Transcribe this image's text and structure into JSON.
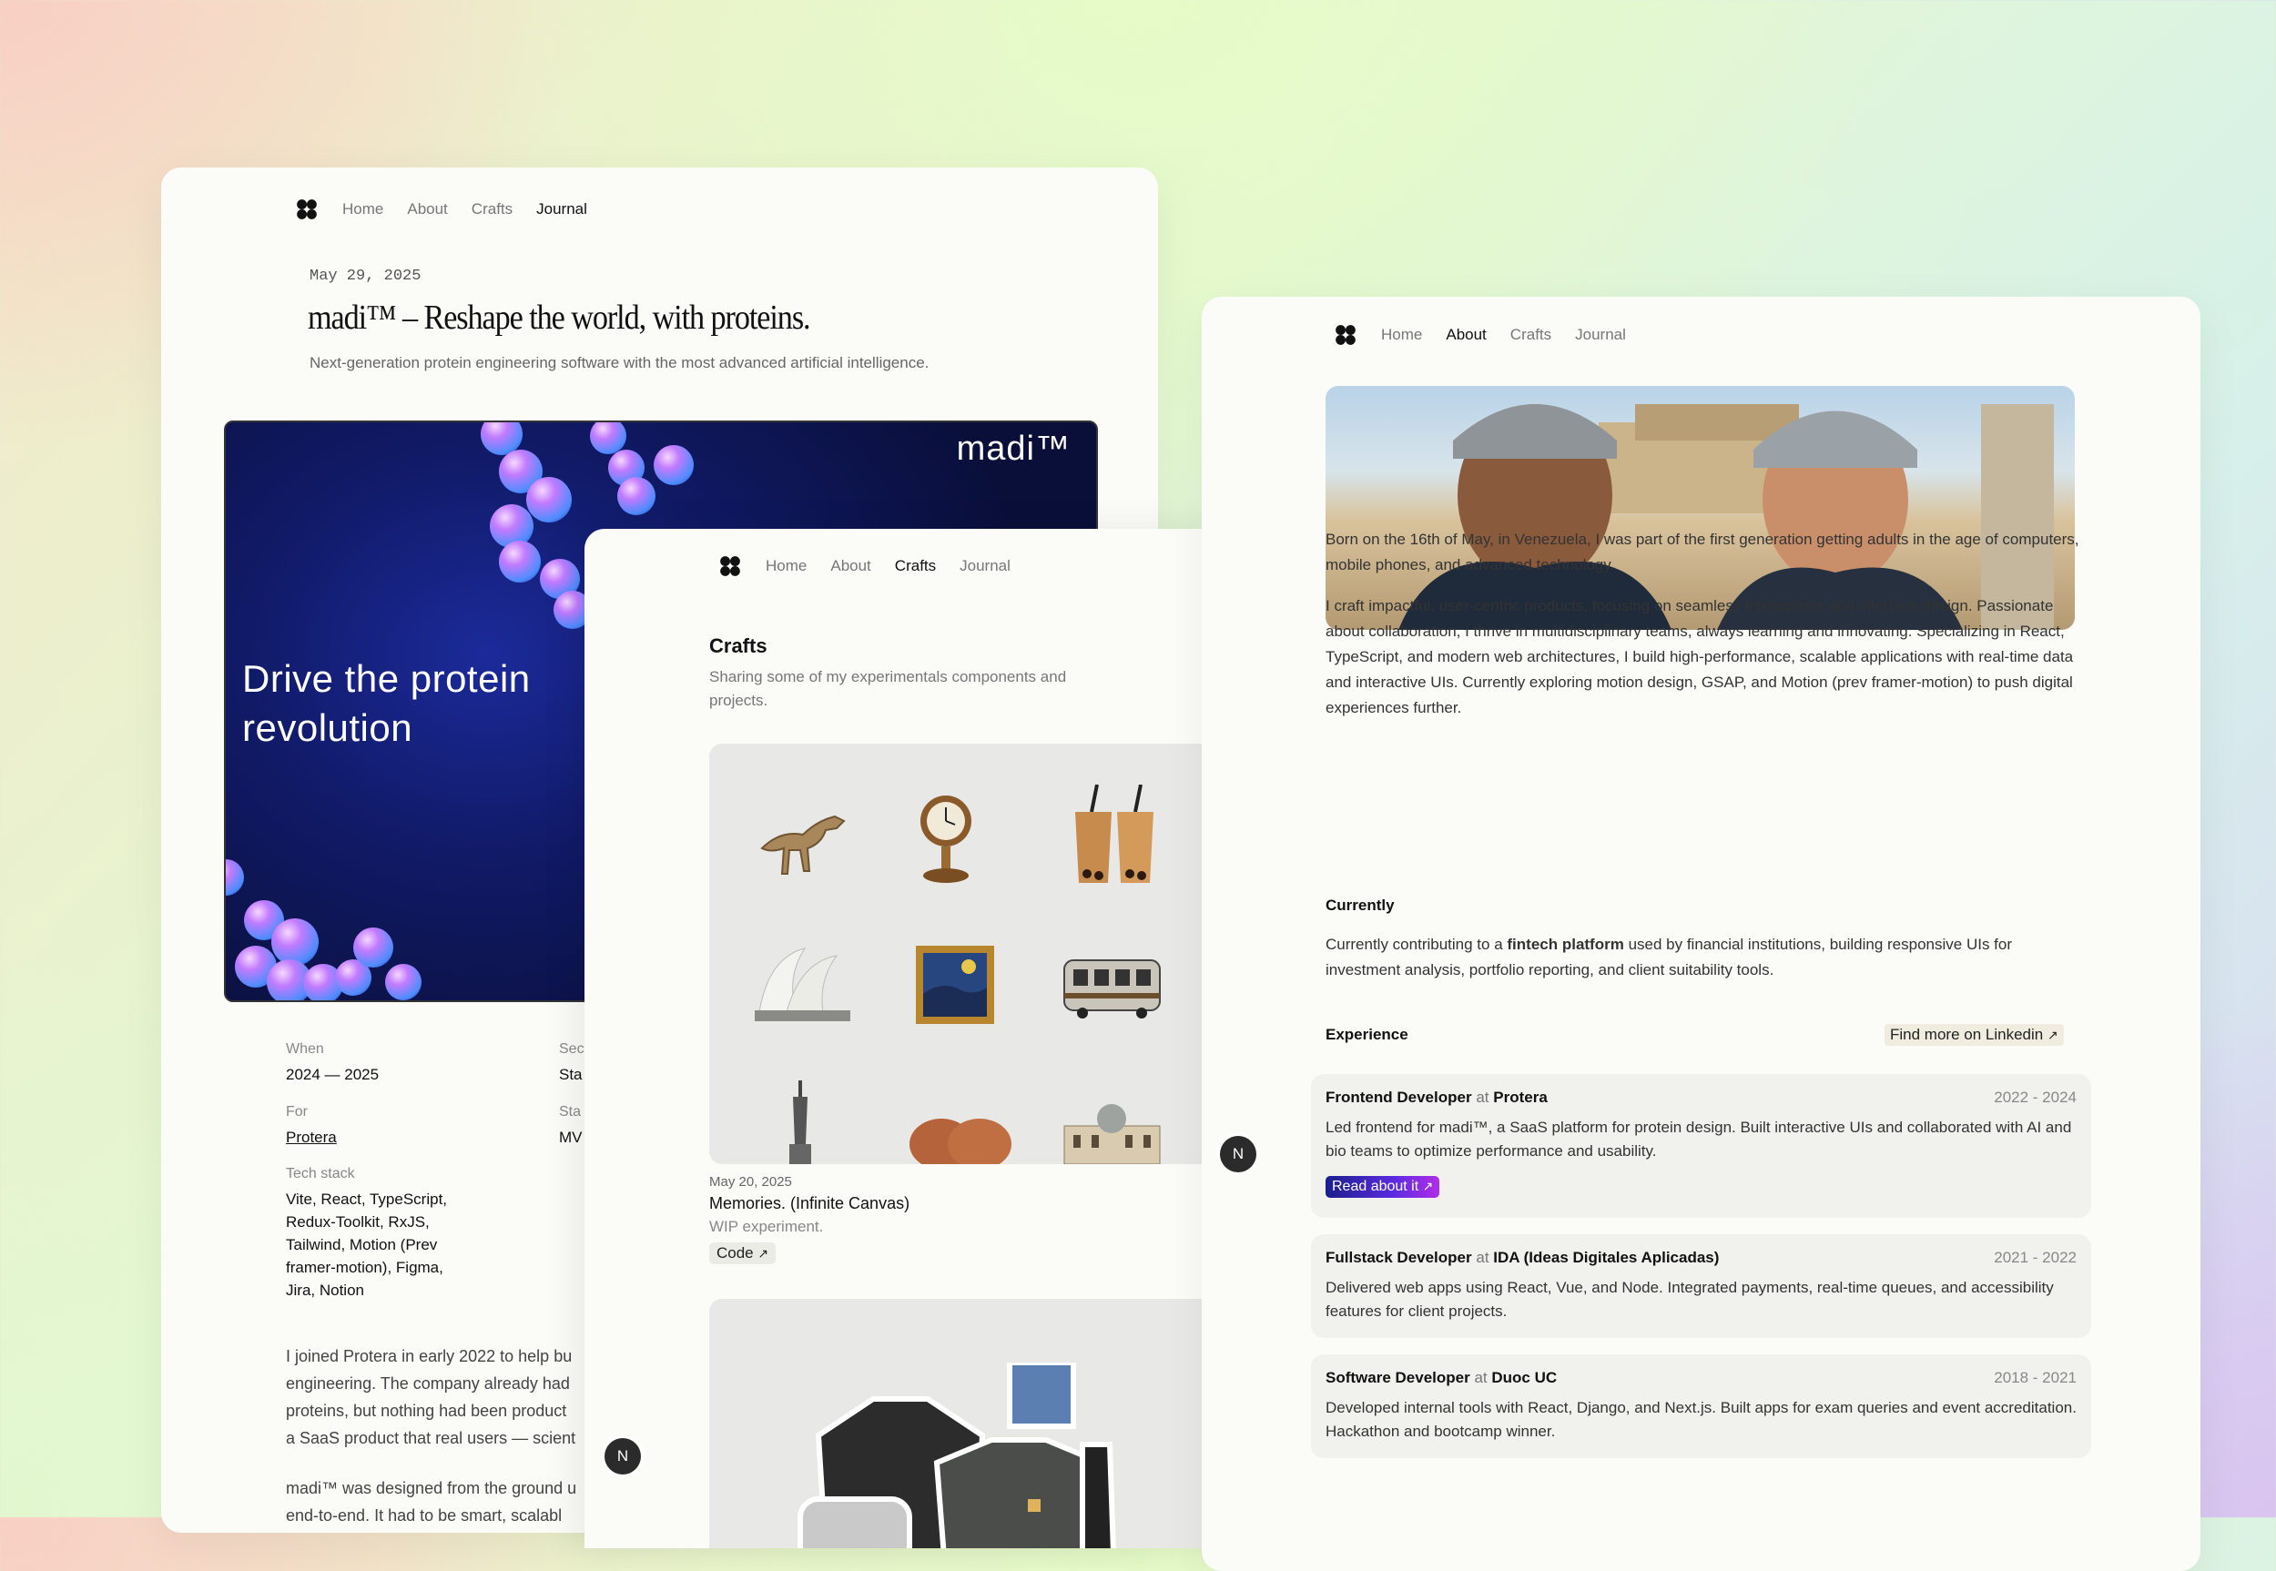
{
  "nav": {
    "home": "Home",
    "about": "About",
    "crafts": "Crafts",
    "journal": "Journal"
  },
  "journal": {
    "date": "May 29, 2025",
    "title": "madi™ – Reshape the world, with proteins.",
    "subtitle": "Next-generation protein engineering software with the most advanced artificial intelligence.",
    "hero_brand": "madi™",
    "hero_text": "Drive the protein revolution",
    "meta": {
      "when_label": "When",
      "when_value": "2024 — 2025",
      "sec_label": "Sec",
      "sec_value": "Sta",
      "for_label": "For",
      "for_value": "Protera",
      "sta_label": "Sta",
      "sta_value": "MV",
      "tech_label": "Tech stack",
      "tech_lines": [
        "Vite, React, TypeScript,",
        "Redux-Toolkit, RxJS,",
        "Tailwind, Motion (Prev",
        "framer-motion), Figma,",
        "Jira, Notion"
      ]
    },
    "paragraph_lines": [
      "I joined Protera in early 2022 to help bu",
      "engineering. The company already had",
      "proteins, but nothing had been product",
      "a SaaS product that real users — scient"
    ],
    "paragraph2_lines": [
      "madi™ was designed from the ground u",
      "end-to-end. It had to be smart, scalabl"
    ]
  },
  "crafts": {
    "title": "Crafts",
    "subtitle": "Sharing some of my experimentals components and projects.",
    "item": {
      "date": "May 20, 2025",
      "name": "Memories. (Infinite Canvas)",
      "desc": "WIP experiment.",
      "code": "Code"
    }
  },
  "about": {
    "p1": "Born on the 16th of May, in Venezuela, I was part of the first generation getting adults in the age of computers, mobile phones, and advanced technology.",
    "p2": "I craft impactful, user-centric products, focusing on seamless interactions and interface design. Passionate about collaboration, I thrive in multidisciplinary teams, always learning and innovating. Specializing in React, TypeScript, and modern web architectures, I build high-performance, scalable applications with real-time data and interactive UIs. Currently exploring motion design, GSAP, and Motion (prev framer-motion) to push digital experiences further.",
    "currently_heading": "Currently",
    "currently_pre": "Currently contributing to a ",
    "currently_bold": "fintech platform",
    "currently_post": " used by financial institutions, building responsive UIs for investment analysis, portfolio reporting, and client suitability tools.",
    "experience_heading": "Experience",
    "linkedin": "Find more on Linkedin",
    "jobs": [
      {
        "role": "Frontend Developer",
        "at": "at",
        "company": "Protera",
        "years": "2022 - 2024",
        "desc": "Led frontend for madi™, a SaaS platform for protein design. Built interactive UIs and collaborated with AI and bio teams to optimize performance and usability.",
        "link": "Read about it"
      },
      {
        "role": "Fullstack Developer",
        "at": "at",
        "company": "IDA (Ideas Digitales Aplicadas)",
        "years": "2021 - 2022",
        "desc": "Delivered web apps using React, Vue, and Node. Integrated payments, real-time queues, and accessibility features for client projects."
      },
      {
        "role": "Software Developer",
        "at": "at",
        "company": "Duoc UC",
        "years": "2018 - 2021",
        "desc": "Developed internal tools with React, Django, and Next.js. Built apps for exam queries and event accreditation. Hackathon and bootcamp winner."
      }
    ]
  },
  "fab_label": "N",
  "icons": {
    "logo": "clover-logo-icon",
    "external": "arrow-up-right-icon"
  }
}
